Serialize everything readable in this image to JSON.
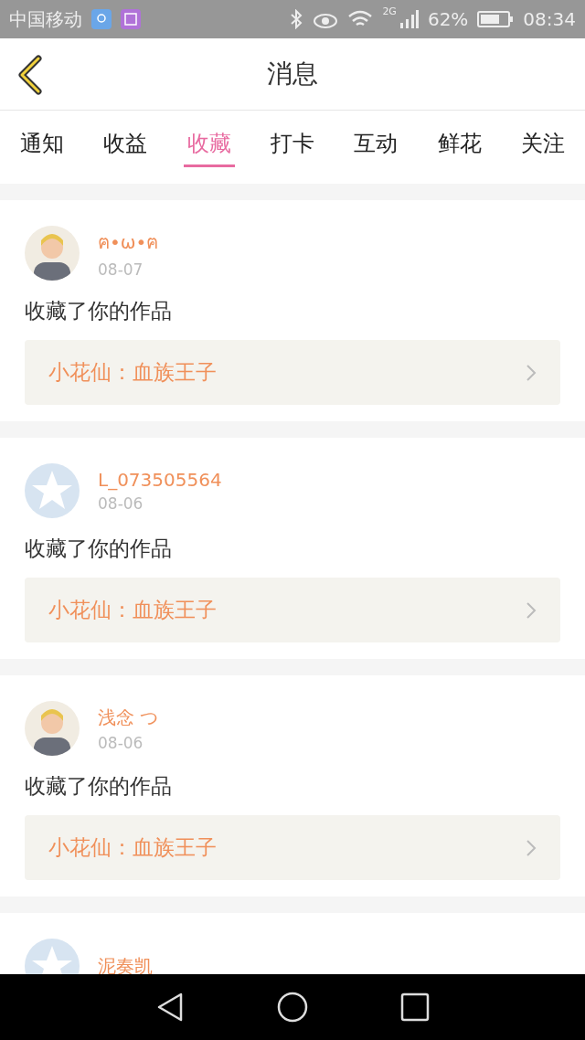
{
  "status_bar": {
    "carrier": "中国移动",
    "network": "2G",
    "battery": "62%",
    "time": "08:34"
  },
  "header": {
    "title": "消息"
  },
  "tabs": [
    {
      "label": "通知",
      "selected": false
    },
    {
      "label": "收益",
      "selected": false
    },
    {
      "label": "收藏",
      "selected": true
    },
    {
      "label": "打卡",
      "selected": false
    },
    {
      "label": "互动",
      "selected": false
    },
    {
      "label": "鲜花",
      "selected": false
    },
    {
      "label": "关注",
      "selected": false
    }
  ],
  "messages": [
    {
      "user": "ฅ•ω•ฅ",
      "date": "08-07",
      "action": "收藏了你的作品",
      "work": "小花仙：血族王子"
    },
    {
      "avatar": {
        "kind": "default"
      },
      "user": "L_073505564",
      "date": "08-06",
      "action": "收藏了你的作品",
      "work": "小花仙：血族王子"
    },
    {
      "user": "浅念 つ",
      "date": "08-06",
      "action": "收藏了你的作品",
      "work": "小花仙：血族王子"
    },
    {
      "avatar": {
        "kind": "default"
      },
      "user": "泥奏凯"
    }
  ]
}
